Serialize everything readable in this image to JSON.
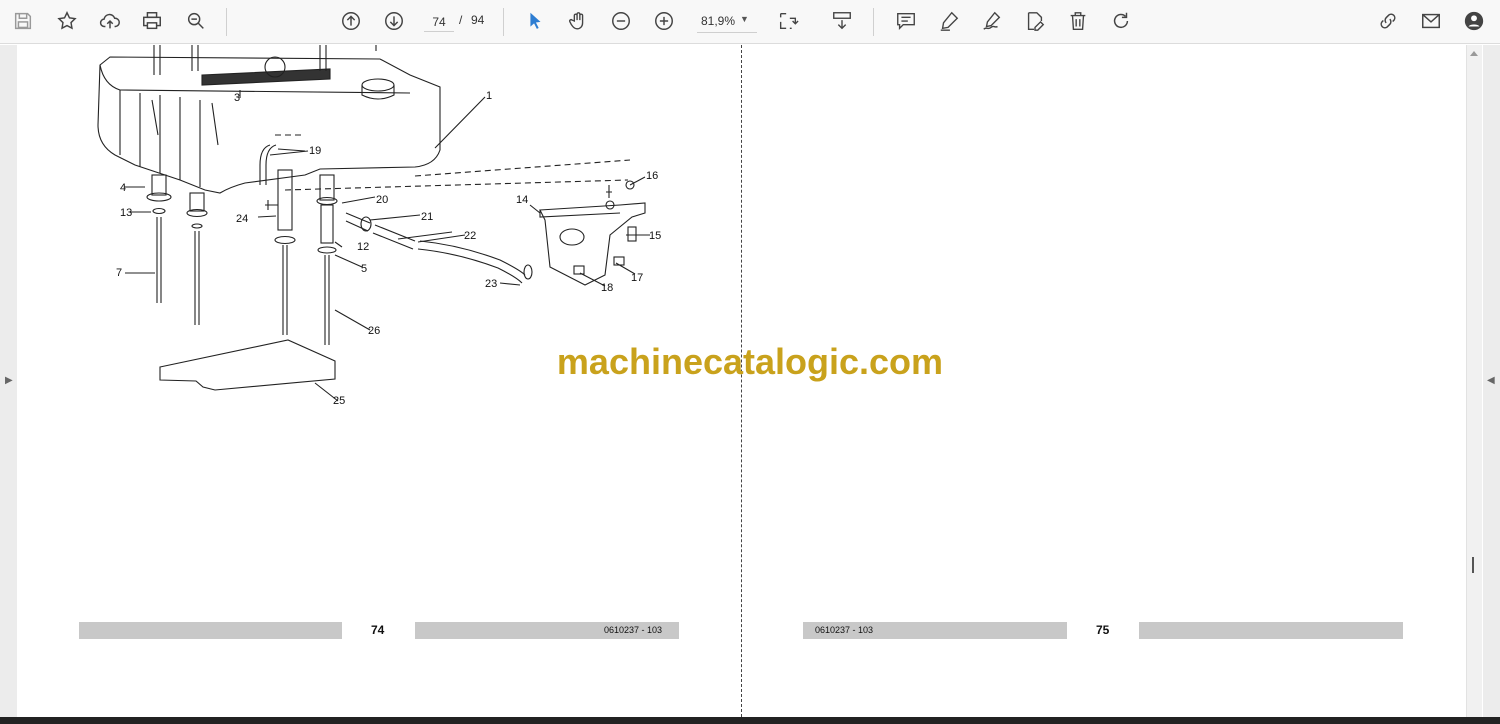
{
  "toolbar": {
    "page_current": "74",
    "page_separator": "/",
    "page_total": "94",
    "zoom": "81,9%",
    "icons": [
      "save-icon",
      "star-icon",
      "upload-icon",
      "print-icon",
      "zoom-search-icon",
      "prev-page-icon",
      "next-page-icon",
      "cursor-icon",
      "hand-icon",
      "zoom-out-icon",
      "zoom-in-icon",
      "fit-page-icon",
      "scroll-mode-icon",
      "comment-icon",
      "highlight-icon",
      "sign-icon",
      "edit-pdf-icon",
      "delete-icon",
      "rotate-icon",
      "link-icon",
      "mail-icon",
      "account-icon"
    ],
    "accent": "#2d7dd2"
  },
  "pages": {
    "left": {
      "number": "74",
      "code": "0610237 - 103"
    },
    "right": {
      "number": "75",
      "code": "0610237 - 103"
    }
  },
  "diagram": {
    "callouts": [
      "1",
      "3",
      "4",
      "5",
      "7",
      "12",
      "13",
      "14",
      "15",
      "16",
      "17",
      "18",
      "19",
      "20",
      "21",
      "22",
      "23",
      "24",
      "25",
      "26"
    ]
  },
  "watermark": {
    "text": "machinecatalogic.com",
    "color": "#c9a21c"
  }
}
